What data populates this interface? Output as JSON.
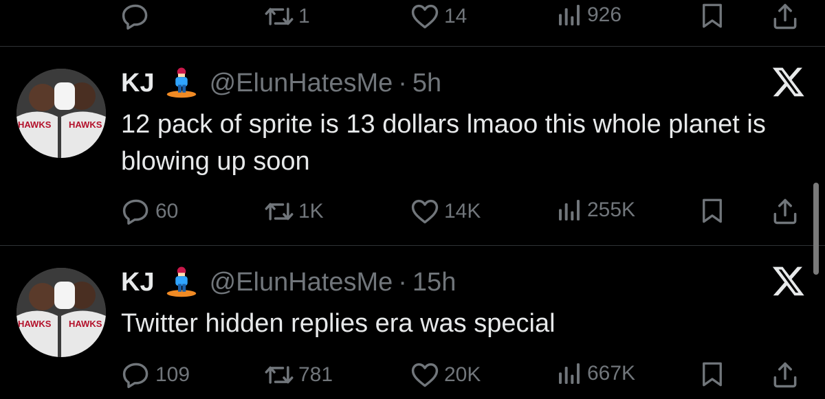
{
  "top_actions": {
    "replies": "",
    "reposts": "1",
    "likes": "14",
    "views": "926"
  },
  "tweets": [
    {
      "name": "KJ",
      "handle": "@ElunHatesMe",
      "separator": "·",
      "time": "5h",
      "text": "12 pack of sprite is 13 dollars lmaoo this whole planet is blowing up soon",
      "replies": "60",
      "reposts": "1K",
      "likes": "14K",
      "views": "255K"
    },
    {
      "name": "KJ",
      "handle": "@ElunHatesMe",
      "separator": "·",
      "time": "15h",
      "text": "Twitter hidden replies era was special",
      "replies": "109",
      "reposts": "781",
      "likes": "20K",
      "views": "667K"
    }
  ],
  "icons": {
    "reply": "reply-icon",
    "repost": "repost-icon",
    "like": "heart-icon",
    "views": "views-icon",
    "bookmark": "bookmark-icon",
    "share": "share-icon",
    "logo": "x-logo-icon",
    "badge": "snowboarder-emoji-icon"
  },
  "colors": {
    "background": "#000000",
    "text": "#e7e9ea",
    "secondary": "#71767b",
    "divider": "#2f3336"
  }
}
